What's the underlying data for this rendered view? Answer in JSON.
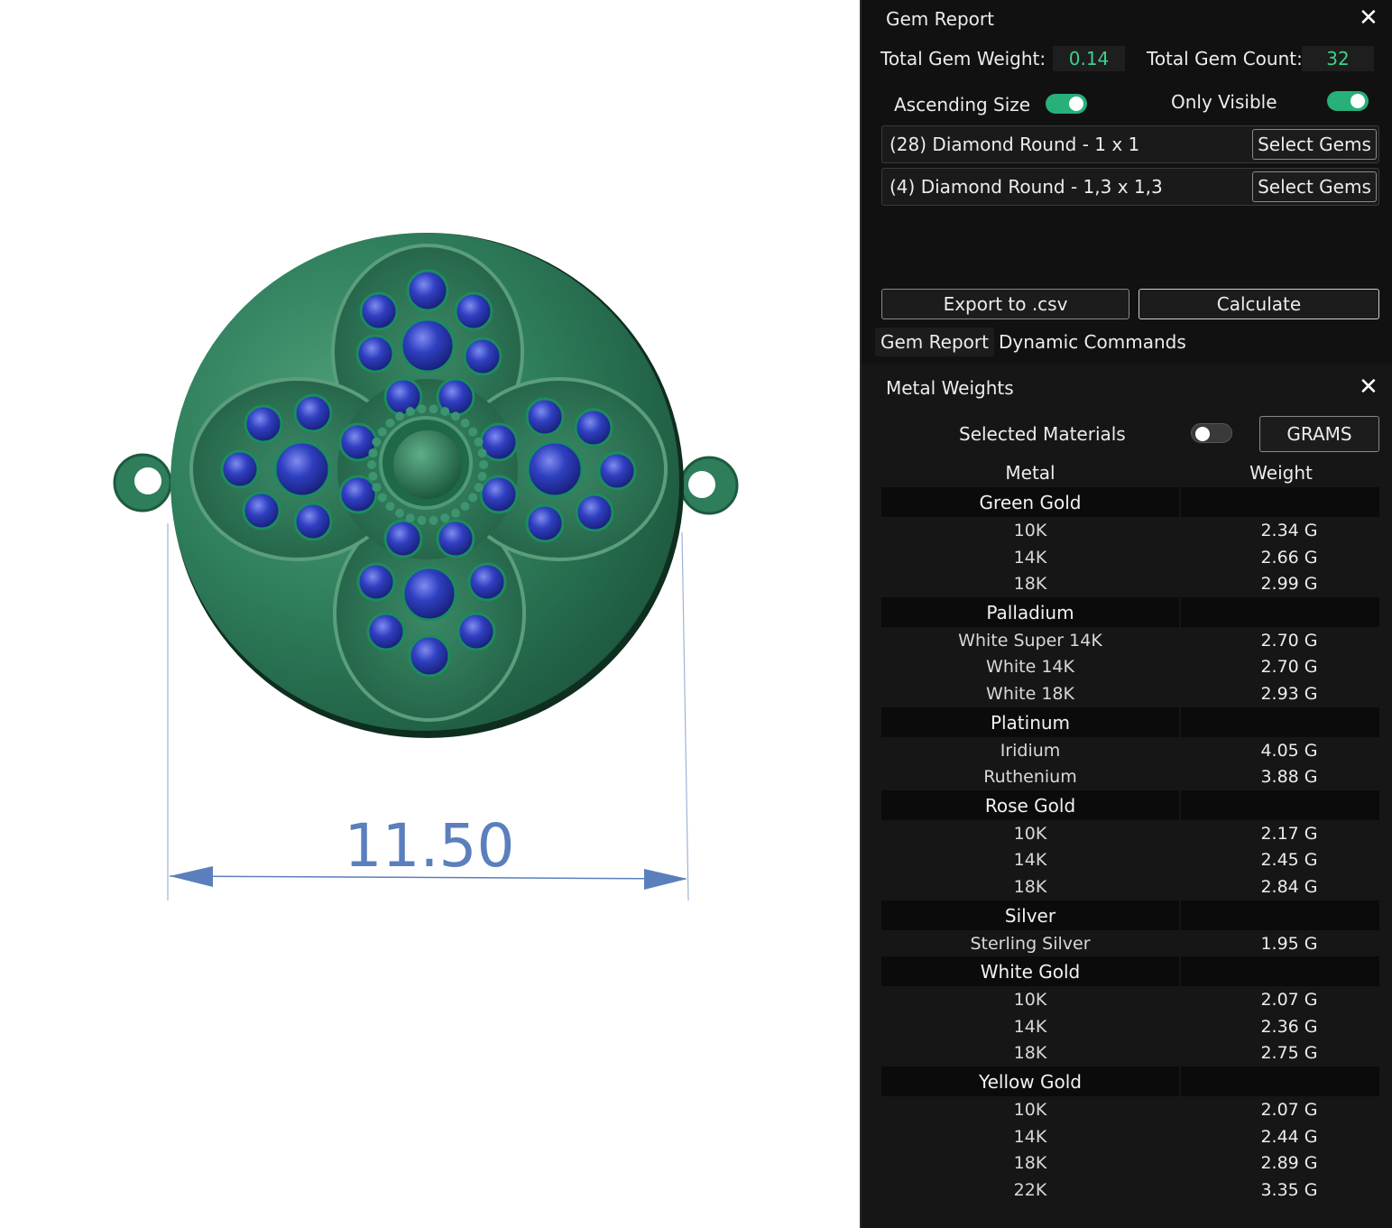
{
  "dimension": {
    "value": "11.50"
  },
  "colors": {
    "metal_green": "#2e7d5b",
    "gem_blue": "#2a3ab0",
    "dimension_blue": "#5b7fbd",
    "panel_bg": "#111111",
    "accent_green": "#27b07a"
  },
  "gem_report": {
    "title": "Gem Report",
    "close_icon": "close-icon",
    "total_weight_label": "Total Gem Weight:",
    "total_weight_value": "0.14",
    "total_count_label": "Total Gem Count:",
    "total_count_value": "32",
    "ascending_size_label": "Ascending Size",
    "ascending_size_on": true,
    "only_visible_label": "Only Visible",
    "only_visible_on": true,
    "gems": [
      {
        "label": "(28) Diamond Round - 1 x 1",
        "button": "Select Gems"
      },
      {
        "label": "(4) Diamond Round - 1,3 x 1,3",
        "button": "Select Gems"
      }
    ],
    "export_button": "Export to .csv",
    "calculate_button": "Calculate"
  },
  "tabs": [
    {
      "label": "Gem Report",
      "active": true
    },
    {
      "label": "Dynamic Commands",
      "active": false
    }
  ],
  "metal_weights": {
    "title": "Metal Weights",
    "close_icon": "close-icon",
    "selected_materials_label": "Selected Materials",
    "selected_materials_on": false,
    "unit_button": "GRAMS",
    "col_metal": "Metal",
    "col_weight": "Weight",
    "groups": [
      {
        "name": "Green Gold",
        "items": [
          {
            "name": "10K",
            "weight": "2.34 G"
          },
          {
            "name": "14K",
            "weight": "2.66 G"
          },
          {
            "name": "18K",
            "weight": "2.99 G"
          }
        ]
      },
      {
        "name": "Palladium",
        "items": [
          {
            "name": "White Super 14K",
            "weight": "2.70 G"
          },
          {
            "name": "White 14K",
            "weight": "2.70 G"
          },
          {
            "name": "White 18K",
            "weight": "2.93 G"
          }
        ]
      },
      {
        "name": "Platinum",
        "items": [
          {
            "name": "Iridium",
            "weight": "4.05 G"
          },
          {
            "name": "Ruthenium",
            "weight": "3.88 G"
          }
        ]
      },
      {
        "name": "Rose Gold",
        "items": [
          {
            "name": "10K",
            "weight": "2.17 G"
          },
          {
            "name": "14K",
            "weight": "2.45 G"
          },
          {
            "name": "18K",
            "weight": "2.84 G"
          }
        ]
      },
      {
        "name": "Silver",
        "items": [
          {
            "name": "Sterling Silver",
            "weight": "1.95 G"
          }
        ]
      },
      {
        "name": "White Gold",
        "items": [
          {
            "name": "10K",
            "weight": "2.07 G"
          },
          {
            "name": "14K",
            "weight": "2.36 G"
          },
          {
            "name": "18K",
            "weight": "2.75 G"
          }
        ]
      },
      {
        "name": "Yellow Gold",
        "items": [
          {
            "name": "10K",
            "weight": "2.07 G"
          },
          {
            "name": "14K",
            "weight": "2.44 G"
          },
          {
            "name": "18K",
            "weight": "2.89 G"
          },
          {
            "name": "22K",
            "weight": "3.35 G"
          }
        ]
      }
    ]
  }
}
